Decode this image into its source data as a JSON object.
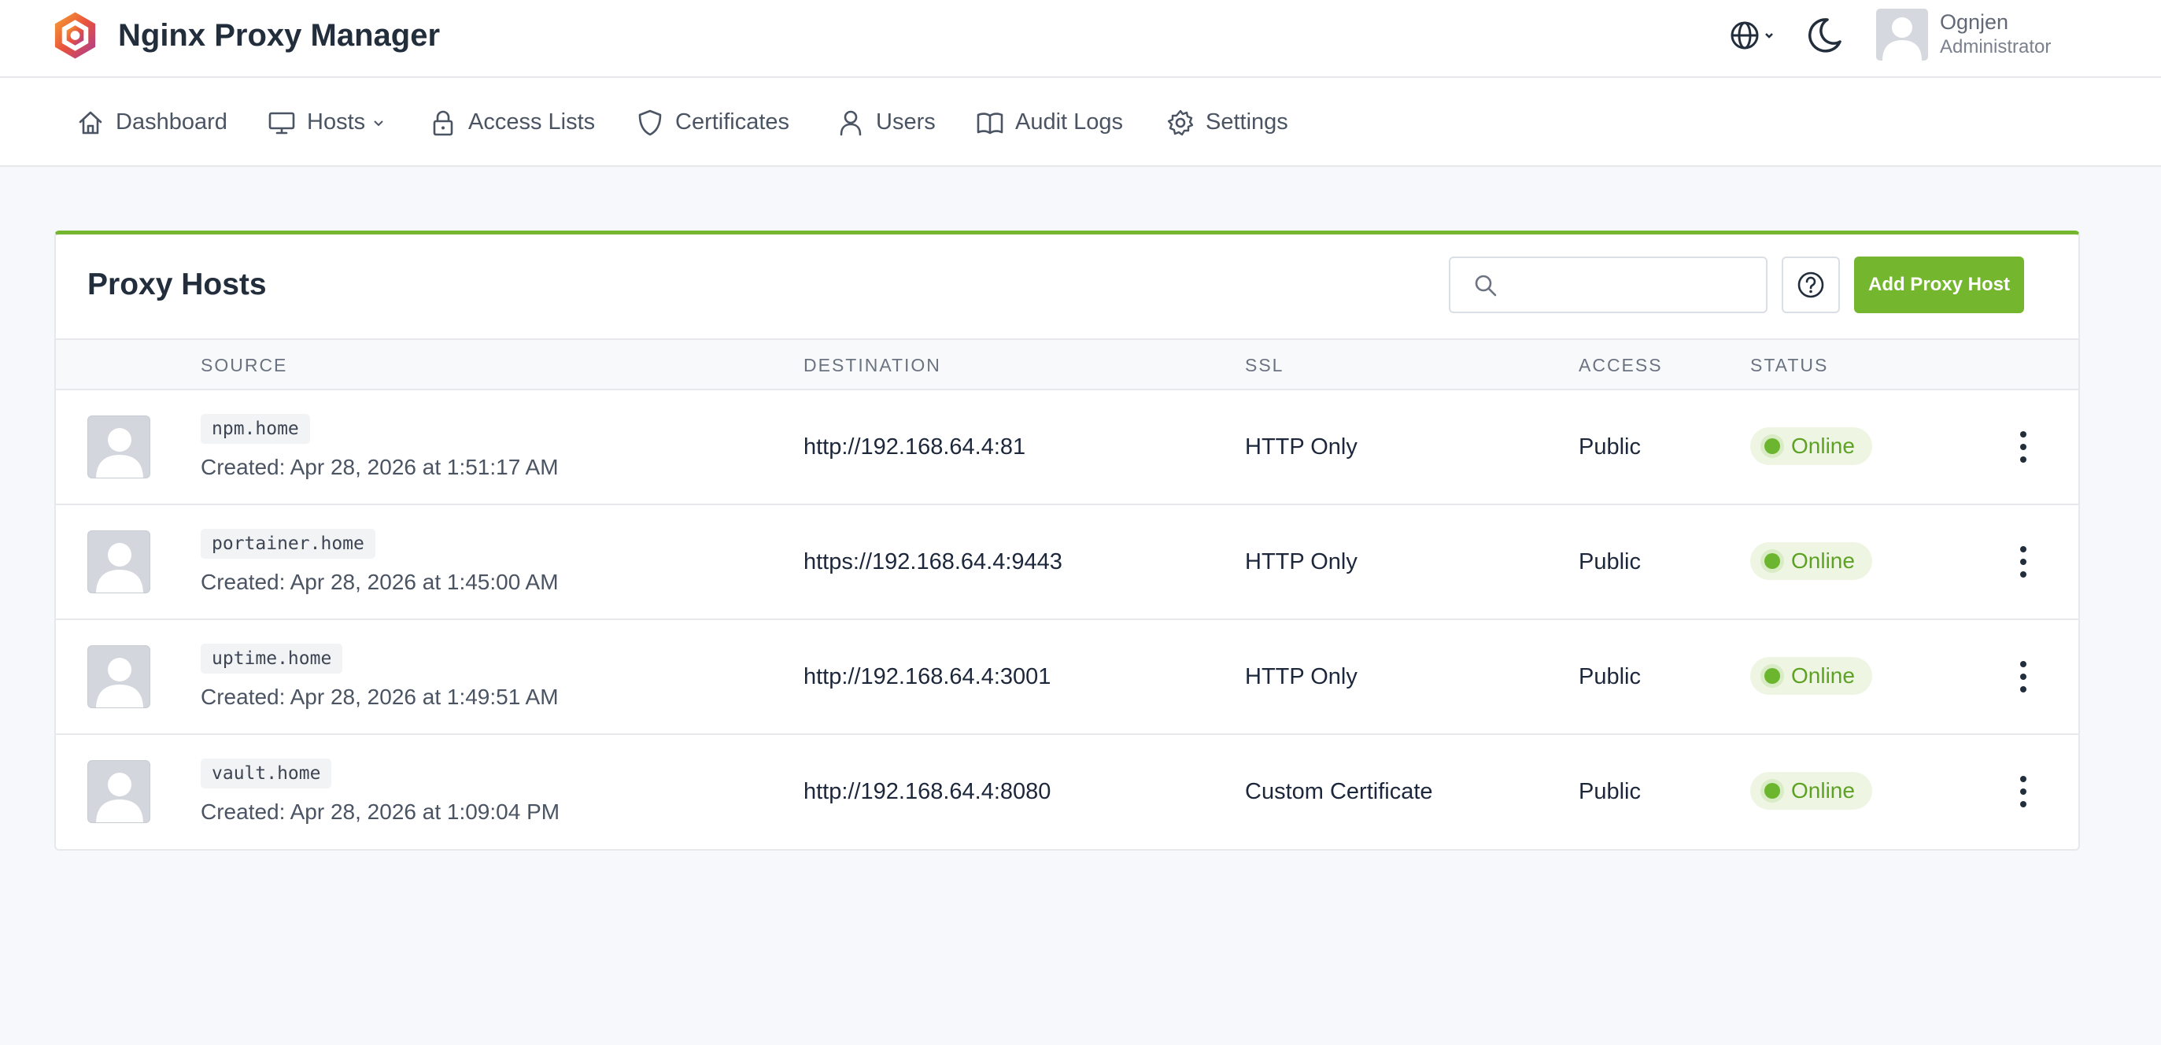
{
  "header": {
    "app_title": "Nginx Proxy Manager",
    "user_name": "Ognjen",
    "user_role": "Administrator"
  },
  "nav": {
    "items": [
      {
        "label": "Dashboard",
        "icon": "home-icon"
      },
      {
        "label": "Hosts",
        "icon": "monitor-icon",
        "dropdown": true
      },
      {
        "label": "Access Lists",
        "icon": "lock-icon"
      },
      {
        "label": "Certificates",
        "icon": "shield-icon"
      },
      {
        "label": "Users",
        "icon": "user-icon"
      },
      {
        "label": "Audit Logs",
        "icon": "book-icon"
      },
      {
        "label": "Settings",
        "icon": "gear-icon"
      }
    ]
  },
  "card": {
    "title": "Proxy Hosts",
    "search_placeholder": "",
    "add_button": "Add Proxy Host"
  },
  "table": {
    "columns": [
      "SOURCE",
      "DESTINATION",
      "SSL",
      "ACCESS",
      "STATUS"
    ],
    "rows": [
      {
        "domain": "npm.home",
        "created": "Created: Apr 28, 2026 at 1:51:17 AM",
        "destination": "http://192.168.64.4:81",
        "ssl": "HTTP Only",
        "access": "Public",
        "status": "Online"
      },
      {
        "domain": "portainer.home",
        "created": "Created: Apr 28, 2026 at 1:45:00 AM",
        "destination": "https://192.168.64.4:9443",
        "ssl": "HTTP Only",
        "access": "Public",
        "status": "Online"
      },
      {
        "domain": "uptime.home",
        "created": "Created: Apr 28, 2026 at 1:49:51 AM",
        "destination": "http://192.168.64.4:3001",
        "ssl": "HTTP Only",
        "access": "Public",
        "status": "Online"
      },
      {
        "domain": "vault.home",
        "created": "Created: Apr 28, 2026 at 1:09:04 PM",
        "destination": "http://192.168.64.4:8080",
        "ssl": "Custom Certificate",
        "access": "Public",
        "status": "Online"
      }
    ]
  },
  "colors": {
    "accent": "#74b72e",
    "status_online": "#5ea224",
    "page_background": "#f6f8fb"
  }
}
